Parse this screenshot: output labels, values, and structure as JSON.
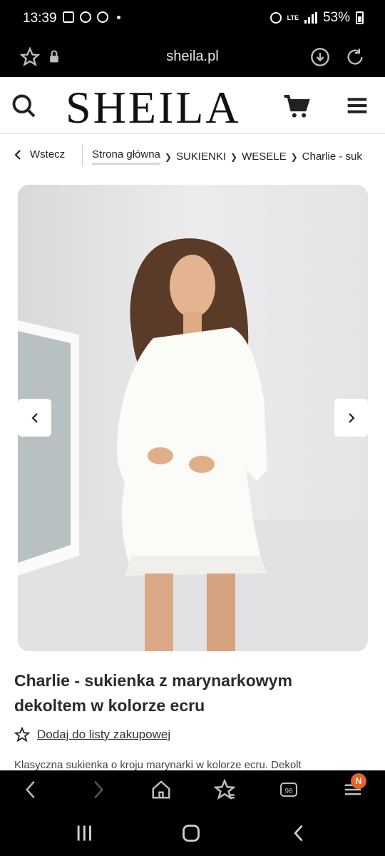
{
  "status_bar": {
    "time": "13:39",
    "network": "LTE",
    "battery": "53%"
  },
  "browser": {
    "url": "sheila.pl"
  },
  "site": {
    "logo": "SHEILA"
  },
  "breadcrumb": {
    "back_label": "Wstecz",
    "items": [
      "Strona główna",
      "SUKIENKI",
      "WESELE",
      "Charlie - suk"
    ]
  },
  "product": {
    "title": "Charlie - sukienka z marynarkowym dekoltem w kolorze ecru",
    "wishlist_label": "Dodaj do listy zakupowej",
    "description_preview": "Klasyczna sukienka o kroju marynarki w kolorze ecru. Dekolt"
  },
  "toolbar": {
    "tabs_count": "98",
    "notification_badge": "N"
  },
  "colors": {
    "badge": "#e8622a",
    "page_bg": "#ffffff",
    "chrome_bg": "#000000"
  }
}
